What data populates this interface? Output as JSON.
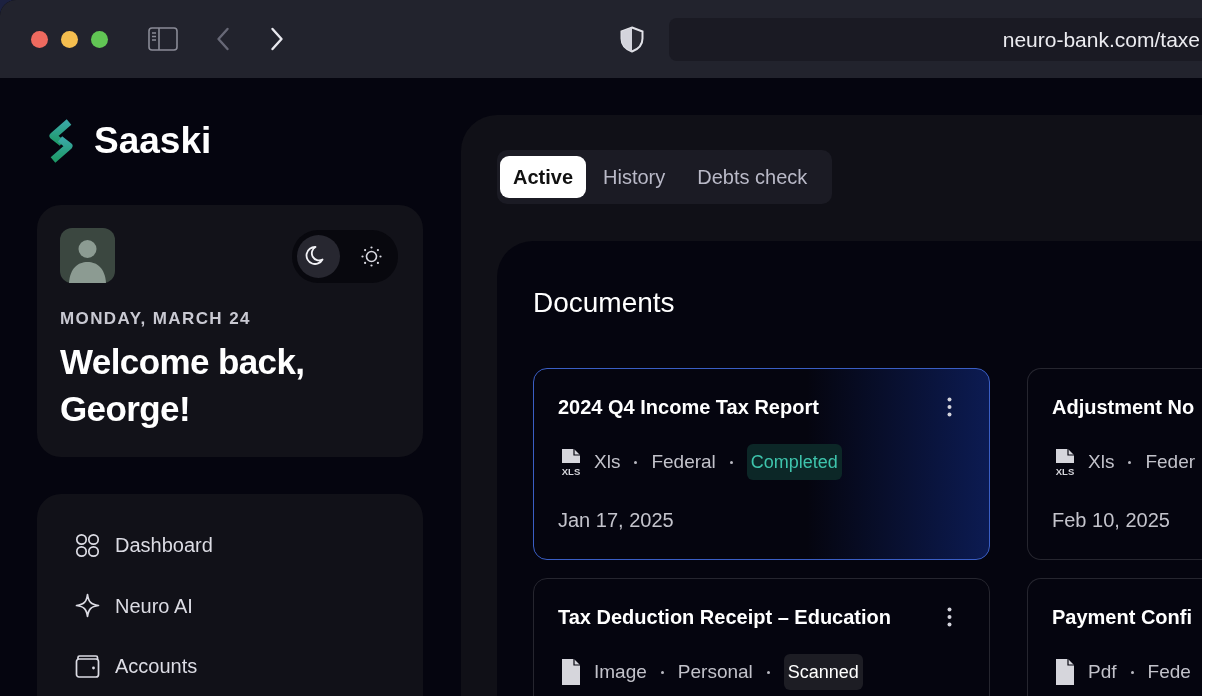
{
  "browser": {
    "back": {
      "disabled": true
    },
    "forward": {
      "disabled": false
    },
    "url": "neuro-bank.com/taxe"
  },
  "sidebar": {
    "brand": "Saaski",
    "profile": {
      "theme_modes": [
        {
          "selected": true
        },
        {
          "selected": false
        }
      ],
      "date": "MONDAY, MARCH 24",
      "greeting": "Welcome back, George!"
    },
    "nav": [
      {
        "label": "Dashboard"
      },
      {
        "label": "Neuro AI"
      },
      {
        "label": "Accounts"
      }
    ]
  },
  "main": {
    "tabs": [
      {
        "label": "Active",
        "selected": true
      },
      {
        "label": "History",
        "selected": false
      },
      {
        "label": "Debts check",
        "selected": false
      }
    ],
    "documents": {
      "title": "Documents",
      "cards": [
        {
          "title": "2024 Q4 Income Tax Report",
          "menu": true,
          "selected": true,
          "icon_text": "XLS",
          "file_type": "Xls",
          "category": "Federal",
          "status": {
            "kind": "completed",
            "label": "Completed"
          },
          "date": "Jan 17, 2025"
        },
        {
          "title": "Adjustment No",
          "selected": false,
          "icon_text": "XLS",
          "file_type": "Xls",
          "category": "Feder",
          "date": "Feb 10, 2025"
        },
        {
          "title": "Tax Deduction Receipt – Education",
          "menu": true,
          "selected": false,
          "file_type": "Image",
          "category": "Personal",
          "status": {
            "kind": "scanned",
            "label": "Scanned"
          }
        },
        {
          "title": "Payment Confi",
          "selected": false,
          "file_type": "Pdf",
          "category": "Fede"
        }
      ]
    }
  }
}
